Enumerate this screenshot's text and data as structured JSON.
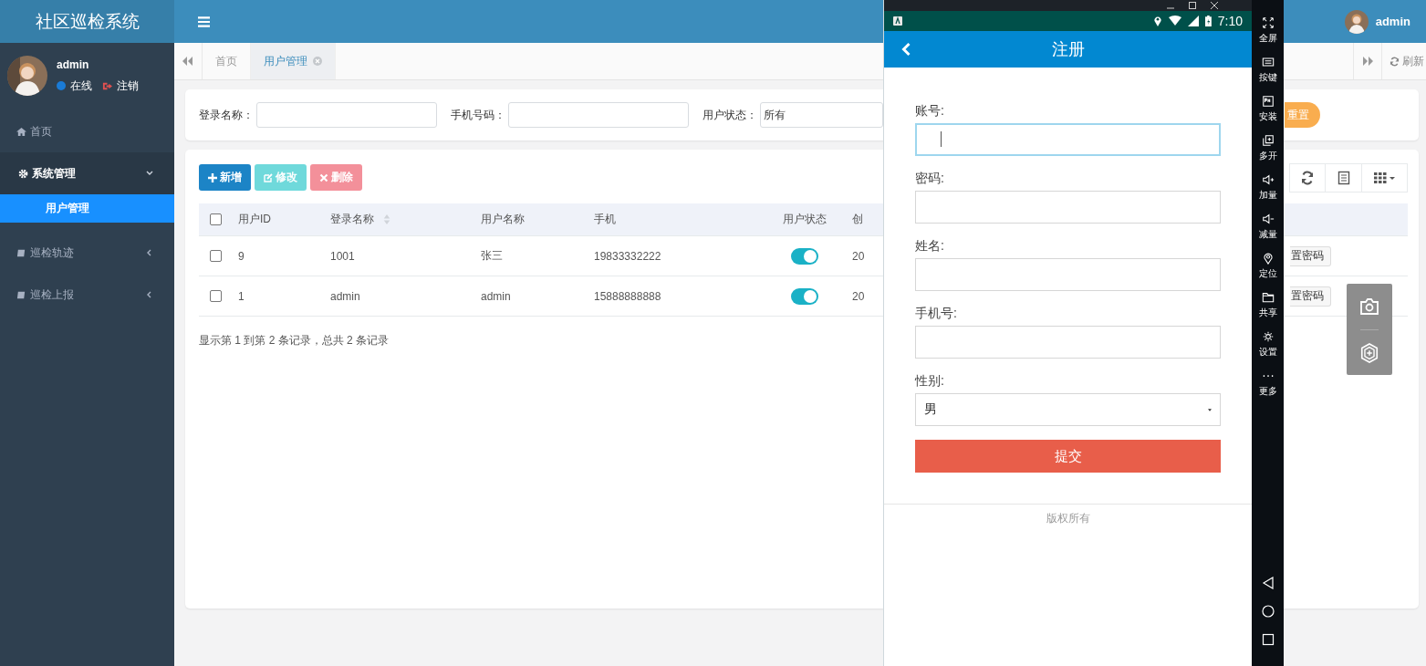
{
  "app": {
    "title": "社区巡检系统",
    "user_name": "admin",
    "user_status": "在线",
    "logout": "注销",
    "header_user": "admin"
  },
  "sidebar": {
    "items": [
      {
        "label": "首页"
      },
      {
        "label": "系统管理",
        "expanded": true,
        "children": [
          {
            "label": "用户管理",
            "selected": true
          }
        ]
      },
      {
        "label": "巡检轨迹",
        "expanded": false
      },
      {
        "label": "巡检上报",
        "expanded": false
      }
    ]
  },
  "tabs": [
    {
      "label": "首页",
      "selected": false
    },
    {
      "label": "用户管理",
      "selected": true
    }
  ],
  "tab_refresh": "刷新",
  "search": {
    "fields": [
      {
        "label": "登录名称：",
        "kind": "input"
      },
      {
        "label": "手机号码：",
        "kind": "input"
      },
      {
        "label": "用户状态：",
        "kind": "select",
        "value": "所有"
      }
    ],
    "reset": "重置"
  },
  "toolbar": {
    "buttons": [
      {
        "label": "新增",
        "kind": "add",
        "disabled": false
      },
      {
        "label": "修改",
        "kind": "edit",
        "disabled": true
      },
      {
        "label": "删除",
        "kind": "delete",
        "disabled": true
      }
    ]
  },
  "table": {
    "all_checked": false,
    "columns": [
      {
        "label": "用户ID"
      },
      {
        "label": "登录名称",
        "sortable": true
      },
      {
        "label": "用户名称"
      },
      {
        "label": "手机"
      },
      {
        "label": "用户状态"
      },
      {
        "label": "创"
      }
    ],
    "rows": [
      {
        "checked": false,
        "cells": [
          "9",
          "1001",
          "张三",
          "19833332222"
        ],
        "status_on": true,
        "created": "20",
        "action": "置密码"
      },
      {
        "checked": false,
        "cells": [
          "1",
          "admin",
          "admin",
          "15888888888"
        ],
        "status_on": true,
        "created": "20",
        "action": "置密码"
      }
    ]
  },
  "pagination_info": "显示第 1 到第 2 条记录，总共 2 条记录",
  "emulator": {
    "time": "7:10",
    "title": "注册",
    "fields": [
      {
        "label": "账号:",
        "kind": "input",
        "focused": true
      },
      {
        "label": "密码:",
        "kind": "input",
        "focused": false
      },
      {
        "label": "姓名:",
        "kind": "input",
        "focused": false
      },
      {
        "label": "手机号:",
        "kind": "input",
        "focused": false
      },
      {
        "label": "性别:",
        "kind": "select",
        "focused": false,
        "value": "男"
      }
    ],
    "submit": "提交",
    "footer": "版权所有",
    "tools": [
      "全屏",
      "按键",
      "安装",
      "多开",
      "加量",
      "减量",
      "定位",
      "共享",
      "设置",
      "更多"
    ]
  }
}
